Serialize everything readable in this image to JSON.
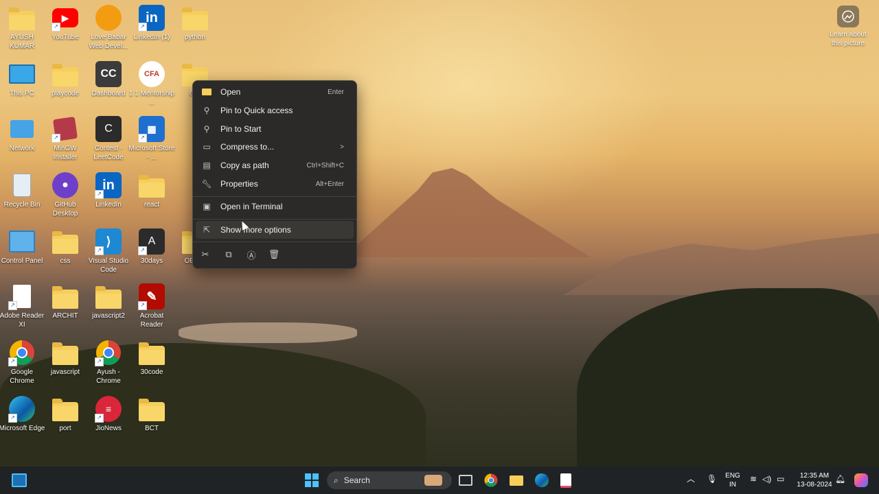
{
  "desktop_icons": [
    {
      "label": "AYUSH KUMAR",
      "icon": "user-folder-icon"
    },
    {
      "label": "YouTube",
      "icon": "youtube-icon"
    },
    {
      "label": "Love Babar Web Devel...",
      "icon": "love-babbar-icon"
    },
    {
      "label": "LinkedIn (1)",
      "icon": "linkedin-icon"
    },
    {
      "label": "python",
      "icon": "folder-icon"
    },
    {
      "label": "This PC",
      "icon": "monitor-icon"
    },
    {
      "label": "playcode",
      "icon": "folder-icon"
    },
    {
      "label": "Dashboard",
      "icon": "cc-icon"
    },
    {
      "label": "1 1 Mentorship ...",
      "icon": "cfa-icon"
    },
    {
      "label": "dj...",
      "icon": "folder-icon"
    },
    {
      "label": "Network",
      "icon": "network-icon"
    },
    {
      "label": "MinGW Installer",
      "icon": "mingw-icon"
    },
    {
      "label": "Contest - LeetCode",
      "icon": "letter-c-icon"
    },
    {
      "label": "Microsoft Store - ...",
      "icon": "store-icon"
    },
    {
      "label": "Recycle Bin",
      "icon": "recycle-bin-icon"
    },
    {
      "label": "GitHub Desktop",
      "icon": "github-icon"
    },
    {
      "label": "LinkedIn",
      "icon": "linkedin-icon"
    },
    {
      "label": "react",
      "icon": "folder-icon"
    },
    {
      "label": "Control Panel",
      "icon": "control-panel-icon"
    },
    {
      "label": "css",
      "icon": "chrome-folder-icon"
    },
    {
      "label": "Visual Studio Code",
      "icon": "vscode-icon"
    },
    {
      "label": "30days",
      "icon": "letter-a-icon"
    },
    {
      "label": "OEM...",
      "icon": "folder-icon"
    },
    {
      "label": "Adobe Reader XI",
      "icon": "document-icon"
    },
    {
      "label": "ARCHIT",
      "icon": "folder-icon"
    },
    {
      "label": "javascript2",
      "icon": "folder-icon"
    },
    {
      "label": "Acrobat Reader",
      "icon": "acrobat-icon"
    },
    {
      "label": "Google Chrome",
      "icon": "chrome-icon"
    },
    {
      "label": "javascript",
      "icon": "folder-icon"
    },
    {
      "label": "Ayush - Chrome",
      "icon": "chrome-profile-icon"
    },
    {
      "label": "30code",
      "icon": "chrome-folder-icon"
    },
    {
      "label": "Microsoft Edge",
      "icon": "edge-icon"
    },
    {
      "label": "port",
      "icon": "chrome-folder-icon"
    },
    {
      "label": "JioNews",
      "icon": "jionews-icon"
    },
    {
      "label": "BCT",
      "icon": "chrome-folder-icon"
    }
  ],
  "context_menu": {
    "items": [
      {
        "label": "Open",
        "accel": "Enter",
        "icon": "folder-open-icon"
      },
      {
        "label": "Pin to Quick access",
        "accel": "",
        "icon": "pin-icon"
      },
      {
        "label": "Pin to Start",
        "accel": "",
        "icon": "pin-icon"
      },
      {
        "label": "Compress to...",
        "accel": "",
        "icon": "archive-icon",
        "submenu": ">"
      },
      {
        "label": "Copy as path",
        "accel": "Ctrl+Shift+C",
        "icon": "copy-path-icon"
      },
      {
        "label": "Properties",
        "accel": "Alt+Enter",
        "icon": "wrench-icon"
      },
      {
        "label": "Open in Terminal",
        "accel": "",
        "icon": "terminal-icon"
      },
      {
        "label": "Show more options",
        "accel": "",
        "icon": "share-icon"
      }
    ],
    "quick_actions": [
      "cut-icon",
      "copy-icon",
      "rename-icon",
      "delete-icon"
    ]
  },
  "learn_about": {
    "label": "Learn about this picture"
  },
  "taskbar": {
    "search_placeholder": "Search",
    "language": "ENG",
    "region": "IN",
    "time": "12:35 AM",
    "date": "13-08-2024"
  }
}
